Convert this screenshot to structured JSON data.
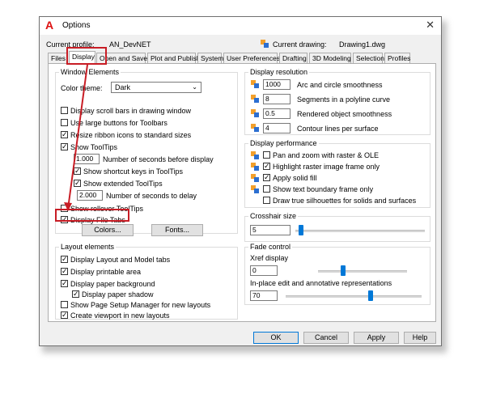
{
  "window": {
    "title": "Options",
    "close": "✕"
  },
  "profile": {
    "label": "Current profile:",
    "value": "AN_DevNET"
  },
  "drawing": {
    "label": "Current drawing:",
    "value": "Drawing1.dwg"
  },
  "tabs": [
    "Files",
    "Display",
    "Open and Save",
    "Plot and Publish",
    "System",
    "User Preferences",
    "Drafting",
    "3D Modeling",
    "Selection",
    "Profiles"
  ],
  "window_elements": {
    "title": "Window Elements",
    "color_theme_label": "Color theme:",
    "color_theme_value": "Dark",
    "scroll_bars": "Display scroll bars in drawing window",
    "large_buttons": "Use large buttons for Toolbars",
    "resize_icons": "Resize ribbon icons to standard sizes",
    "show_tooltips": "Show ToolTips",
    "seconds_before": "Number of seconds before display",
    "seconds_before_value": "1.000",
    "shortcut_keys": "Show shortcut keys in ToolTips",
    "extended_tooltips": "Show extended ToolTips",
    "seconds_delay": "Number of seconds to delay",
    "seconds_delay_value": "2.000",
    "rollover": "Show rollover ToolTips",
    "file_tabs": "Display File Tabs",
    "colors_button": "Colors...",
    "fonts_button": "Fonts..."
  },
  "layout_elements": {
    "title": "Layout elements",
    "items": [
      "Display Layout and Model tabs",
      "Display printable area",
      "Display paper background",
      "Display paper shadow",
      "Show Page Setup Manager for new layouts",
      "Create viewport in new layouts"
    ]
  },
  "display_resolution": {
    "title": "Display resolution",
    "items": [
      {
        "value": "1000",
        "label": "Arc and circle smoothness"
      },
      {
        "value": "8",
        "label": "Segments in a polyline curve"
      },
      {
        "value": "0.5",
        "label": "Rendered object smoothness"
      },
      {
        "value": "4",
        "label": "Contour lines per surface"
      }
    ]
  },
  "display_performance": {
    "title": "Display performance",
    "items": [
      "Pan and zoom with raster & OLE",
      "Highlight raster image frame only",
      "Apply solid fill",
      "Show text boundary frame only",
      "Draw true silhouettes for solids and surfaces"
    ]
  },
  "crosshair": {
    "title": "Crosshair size",
    "value": "5",
    "level": 5
  },
  "fade": {
    "title": "Fade control",
    "xref_label": "Xref display",
    "xref_value": "0",
    "inplace_label": "In-place edit and annotative representations",
    "inplace_value": "70"
  },
  "buttons": {
    "ok": "OK",
    "cancel": "Cancel",
    "apply": "Apply",
    "help": "Help"
  },
  "colors": {
    "highlight": "#c81d25",
    "accent": "#0078d7"
  }
}
